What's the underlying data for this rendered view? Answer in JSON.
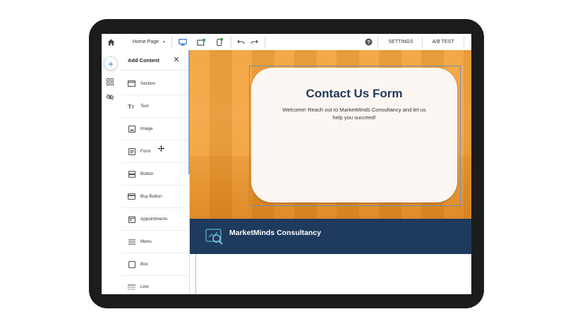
{
  "toolbar": {
    "page_selector": "Home Page",
    "settings_label": "SETTINGS",
    "ab_test_label": "A/B TEST",
    "icons": [
      "home-icon",
      "desktop-icon",
      "tablet-add-icon",
      "mobile-icon",
      "undo-icon",
      "redo-icon",
      "help-icon"
    ]
  },
  "rail": {
    "icons": [
      "plus-icon",
      "grid-icon",
      "eye-off-icon"
    ]
  },
  "panel": {
    "title": "Add Content",
    "items": [
      {
        "label": "Section",
        "icon": "section-icon"
      },
      {
        "label": "Text",
        "icon": "text-icon"
      },
      {
        "label": "Image",
        "icon": "image-icon"
      },
      {
        "label": "Form",
        "icon": "form-icon"
      },
      {
        "label": "Button",
        "icon": "button-icon"
      },
      {
        "label": "Buy Button",
        "icon": "card-icon"
      },
      {
        "label": "Appointments",
        "icon": "calendar-icon"
      },
      {
        "label": "Menu",
        "icon": "menu-icon"
      },
      {
        "label": "Box",
        "icon": "box-icon"
      },
      {
        "label": "Line",
        "icon": "line-icon"
      }
    ]
  },
  "canvas": {
    "form_title": "Contact Us Form",
    "form_subtitle": "Welcome! Reach out to MarketMinds Consultancy and let us help you succeed!",
    "company_name": "MarketMinds Consultancy"
  },
  "colors": {
    "hero_orange": "#f4a33c",
    "navy": "#1e3a5c",
    "card": "#fcf7f2",
    "accent_blue": "#2d6fd6"
  }
}
